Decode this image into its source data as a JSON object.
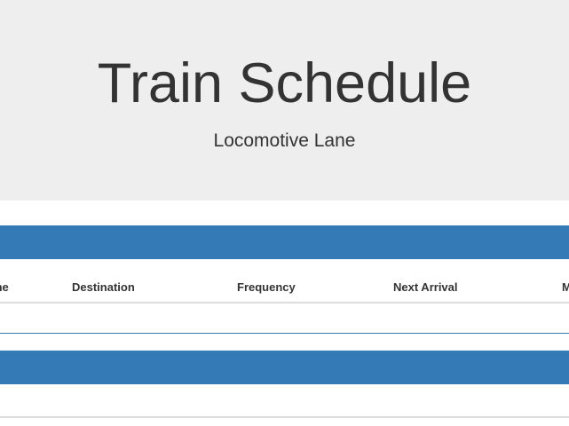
{
  "header": {
    "title": "Train Schedule",
    "subtitle": "Locomotive Lane"
  },
  "schedule_table": {
    "columns": [
      "ine",
      "Destination",
      "Frequency",
      "Next Arrival",
      "M"
    ],
    "rows": []
  },
  "colors": {
    "jumbotron_bg": "#eeeeee",
    "panel_heading": "#337ab7",
    "text": "#333333",
    "border": "#dddddd"
  }
}
